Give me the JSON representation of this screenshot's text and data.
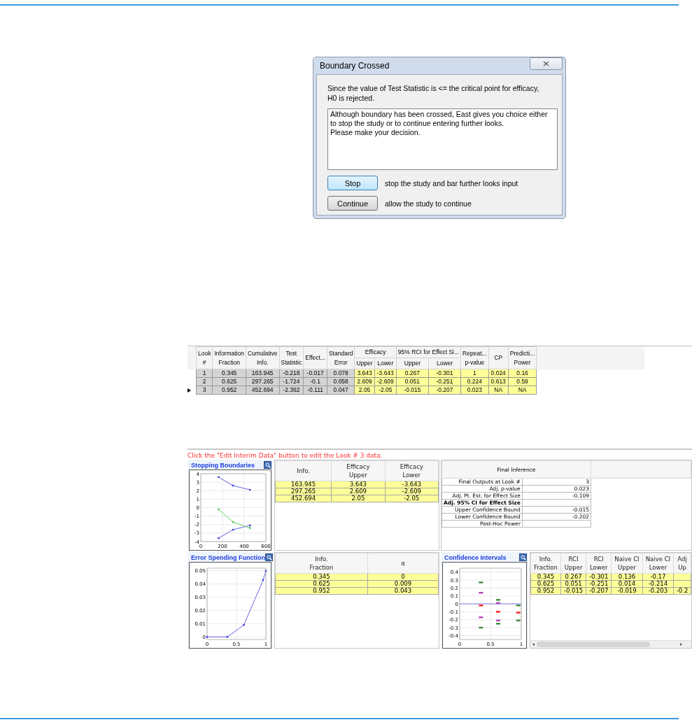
{
  "dialog": {
    "title": "Boundary Crossed",
    "message_lines": [
      "Since the value of Test Statistic is <= the critical point for efficacy,",
      "H0 is rejected."
    ],
    "note_lines": [
      "Although boundary has been crossed, East gives you choice either",
      "to stop the study or to continue entering further looks.",
      "Please make your decision."
    ],
    "actions": [
      {
        "button": "Stop",
        "description": "stop the study and bar further looks input",
        "focused": true
      },
      {
        "button": "Continue",
        "description": "allow the study to continue",
        "focused": false
      }
    ]
  },
  "looks_table": {
    "columns": [
      {
        "label": "Look\n#",
        "kind": "given"
      },
      {
        "label": "Information\nFraction",
        "kind": "given"
      },
      {
        "label": "Cumulative\nInfo.",
        "kind": "given"
      },
      {
        "label": "Test\nStatistic",
        "kind": "given"
      },
      {
        "label": "Effect...",
        "kind": "given"
      },
      {
        "label": "Standard\nError",
        "kind": "given"
      },
      {
        "group": "Efficacy",
        "colspan": 2,
        "subs": [
          "Upper",
          "Lower"
        ],
        "kind": "computed"
      },
      {
        "group": "95% RCI for Effect Si...",
        "colspan": 2,
        "subs": [
          "Upper",
          "Lower"
        ],
        "kind": "computed"
      },
      {
        "label": "Repeat...\np-value",
        "kind": "computed"
      },
      {
        "label": "CP",
        "kind": "computed"
      },
      {
        "label": "Predicti...\nPower",
        "kind": "computed"
      }
    ],
    "rows": [
      {
        "selected": false,
        "cells": [
          "1",
          "0.345",
          "163.945",
          "-0.218",
          "-0.017",
          "0.078",
          "3.643",
          "-3.643",
          "0.267",
          "-0.301",
          "1",
          "0.024",
          "0.16"
        ]
      },
      {
        "selected": false,
        "cells": [
          "2",
          "0.625",
          "297.265",
          "-1.724",
          "-0.1",
          "0.058",
          "2.609",
          "-2.609",
          "0.051",
          "-0.251",
          "0.224",
          "0.613",
          "0.59"
        ]
      },
      {
        "selected": true,
        "cells": [
          "3",
          "0.952",
          "452.694",
          "-2.362",
          "-0.111",
          "0.047",
          "2.05",
          "-2.05",
          "-0.015",
          "-0.207",
          "0.023",
          "NA",
          "NA"
        ]
      }
    ]
  },
  "note": "Click the \"Edit Interim Data\" button to edit the Look # 3 data.",
  "stopping_boundaries": {
    "title": "Stopping Boundaries",
    "chart_data": {
      "type": "line",
      "x": [
        164,
        297,
        453
      ],
      "xlim": [
        0,
        600
      ],
      "ylim": [
        -4,
        4
      ],
      "xticks": [
        0,
        200,
        400,
        600
      ],
      "yticks": [
        -4,
        -3,
        -2,
        -1,
        0,
        1,
        2,
        3,
        4
      ],
      "grid": true,
      "series": [
        {
          "color": "#4040e0",
          "values": [
            3.6,
            2.6,
            2.1
          ]
        },
        {
          "color": "#4040e0",
          "values": [
            -3.6,
            -2.6,
            -2.1
          ]
        },
        {
          "color": "#40c040",
          "values": [
            -0.2,
            -1.7,
            -2.4
          ]
        }
      ]
    },
    "table": {
      "columns": [
        "Info.",
        "Efficacy\nUpper",
        "Efficacy\nLower"
      ],
      "rows": [
        [
          "163.945",
          "3.643",
          "-3.643"
        ],
        [
          "297.265",
          "2.609",
          "-2.609"
        ],
        [
          "452.694",
          "2.05",
          "-2.05"
        ]
      ]
    }
  },
  "final_inference": {
    "title": "Final Inference",
    "rows": [
      {
        "kind": "item",
        "label": "Final Outputs at Look #",
        "value": "3"
      },
      {
        "kind": "item",
        "label": "Adj. p-value",
        "value": "0.023"
      },
      {
        "kind": "item",
        "label": "Adj. Pt. Est. for Effect Size",
        "value": "-0.109"
      },
      {
        "kind": "heading",
        "label": "Adj. 95% CI for Effect Size"
      },
      {
        "kind": "item",
        "label": "Upper Confidence Bound",
        "value": "-0.015"
      },
      {
        "kind": "item",
        "label": "Lower Confidence Bound",
        "value": "-0.202"
      },
      {
        "kind": "item",
        "label": "Post-Hoc Power"
      }
    ]
  },
  "error_spending": {
    "title": "Error Spending Function",
    "chart_data": {
      "type": "line",
      "x": [
        0,
        0.345,
        0.625,
        0.952,
        1
      ],
      "xlim": [
        0,
        1
      ],
      "ylim": [
        -0.002,
        0.052
      ],
      "xticks": [
        0,
        0.5,
        1
      ],
      "yticks": [
        0,
        0.01,
        0.02,
        0.03,
        0.04,
        0.05
      ],
      "grid": true,
      "series": [
        {
          "color": "#4040e0",
          "values": [
            0,
            0,
            0.009,
            0.043,
            0.05
          ]
        }
      ]
    },
    "table": {
      "columns": [
        "Info.\nFraction",
        "α"
      ],
      "rows": [
        [
          "0.345",
          "0"
        ],
        [
          "0.625",
          "0.009"
        ],
        [
          "0.952",
          "0.043"
        ]
      ]
    }
  },
  "confidence_intervals": {
    "title": "Confidence Intervals",
    "chart_data": {
      "type": "scatter",
      "x": [
        0.345,
        0.625,
        0.952
      ],
      "xlim": [
        0,
        1
      ],
      "ylim": [
        -0.45,
        0.45
      ],
      "xticks": [
        0,
        0.5,
        1
      ],
      "yticks": [
        -0.4,
        -0.3,
        -0.2,
        -0.1,
        0,
        0.1,
        0.2,
        0.3,
        0.4
      ],
      "grid": true,
      "ref_lines": [
        {
          "axis": "y",
          "value": 0,
          "color": "#6060f0"
        }
      ],
      "series": [
        {
          "color": "#3a8a3a",
          "values": [
            0.27,
            0.05,
            -0.02
          ]
        },
        {
          "color": "#3a8a3a",
          "values": [
            -0.3,
            -0.25,
            -0.21
          ]
        },
        {
          "color": "#b040b0",
          "values": [
            0.14,
            0.01,
            null
          ]
        },
        {
          "color": "#b040b0",
          "values": [
            -0.17,
            -0.21,
            null
          ]
        },
        {
          "color": "#ff2020",
          "values": [
            -0.02,
            -0.1,
            -0.11
          ]
        }
      ]
    },
    "table": {
      "columns": [
        "Info.\nFraction",
        "RCI\nUpper",
        "RCI\nLower",
        "Naive CI\nUpper",
        "Naive CI\nLower",
        "Adj\nUp"
      ],
      "rows": [
        [
          "0.345",
          "0.267",
          "-0.301",
          "0.136",
          "-0.17"
        ],
        [
          "0.625",
          "0.051",
          "-0.251",
          "0.014",
          "-0.214"
        ],
        [
          "0.952",
          "-0.015",
          "-0.207",
          "-0.019",
          "-0.203",
          "-0.2"
        ]
      ]
    }
  }
}
